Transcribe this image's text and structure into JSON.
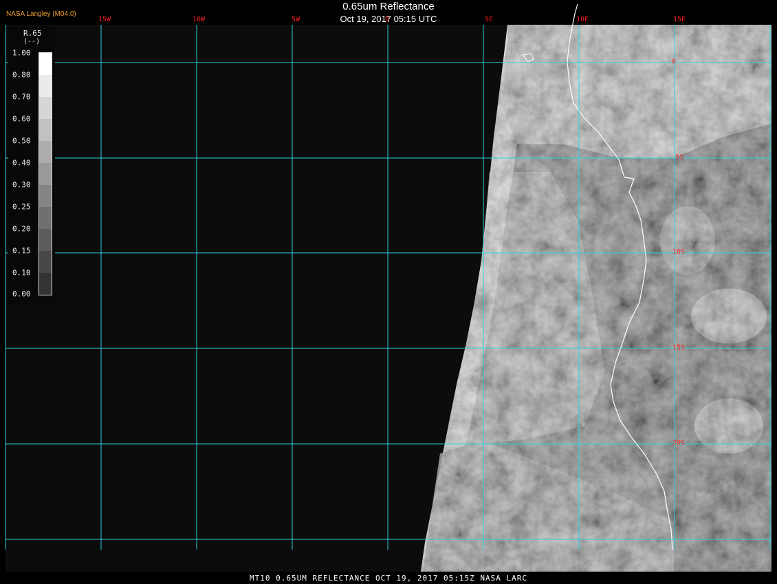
{
  "header": {
    "title": "0.65um Reflectance",
    "subtitle": "Oct 19, 2017 05:15 UTC",
    "brand": "NASA Langley (M04.0)"
  },
  "longitude_labels": [
    "15W",
    "10W",
    "5W",
    "0",
    "5E",
    "10E",
    "15E"
  ],
  "latitude_labels": [
    "0",
    "5S",
    "10S",
    "15S",
    "20S"
  ],
  "legend": {
    "title": "R.65",
    "unit": "(--)",
    "tick_labels": [
      "1.00",
      "0.80",
      "0.70",
      "0.60",
      "0.50",
      "0.40",
      "0.30",
      "0.25",
      "0.20",
      "0.15",
      "0.10",
      "0.00"
    ],
    "colors": [
      "#ffffff",
      "#ebebeb",
      "#d6d6d6",
      "#c2c2c2",
      "#adadad",
      "#999999",
      "#858585",
      "#707070",
      "#5c5c5c",
      "#474747",
      "#333333"
    ]
  },
  "colors": {
    "grid": "#2ad4e0",
    "label": "#ff2020",
    "coast": "#ffffff",
    "space": "#0c0c0c"
  },
  "footer": "MT10  0.65UM REFLECTANCE   OCT 19, 2017 05:15Z   NASA LARC"
}
